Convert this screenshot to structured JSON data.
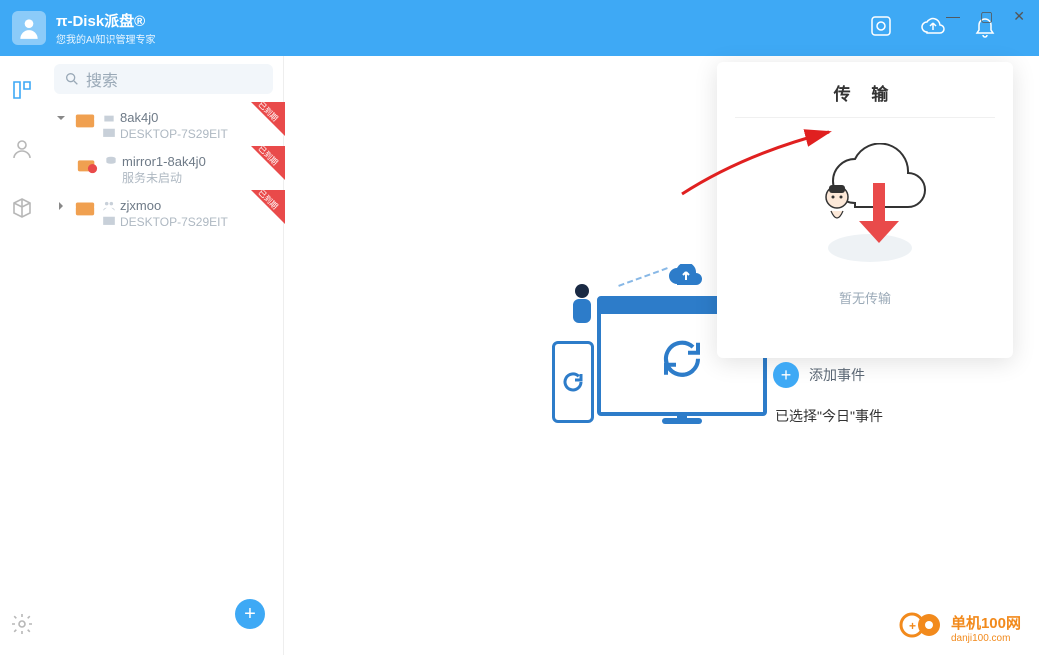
{
  "brand": {
    "title": "π-Disk派盘®",
    "subtitle": "您我的AI知识管理专家"
  },
  "search": {
    "placeholder": "搜索"
  },
  "tree": {
    "ribbon_label": "已到期",
    "items": [
      {
        "name": "8ak4j0",
        "desc": "DESKTOP-7S29EIT",
        "expanded": true
      },
      {
        "name": "mirror1-8ak4j0",
        "desc": "服务未启动",
        "child": true
      },
      {
        "name": "zjxmoo",
        "desc": "DESKTOP-7S29EIT",
        "expanded": false
      }
    ]
  },
  "transfer": {
    "title": "传 输",
    "empty": "暂无传输"
  },
  "events": {
    "add_label": "添加事件",
    "selected_text": "已选择\"今日\"事件"
  },
  "watermark": {
    "line1": "单机100网",
    "line2": "danji100.com"
  }
}
